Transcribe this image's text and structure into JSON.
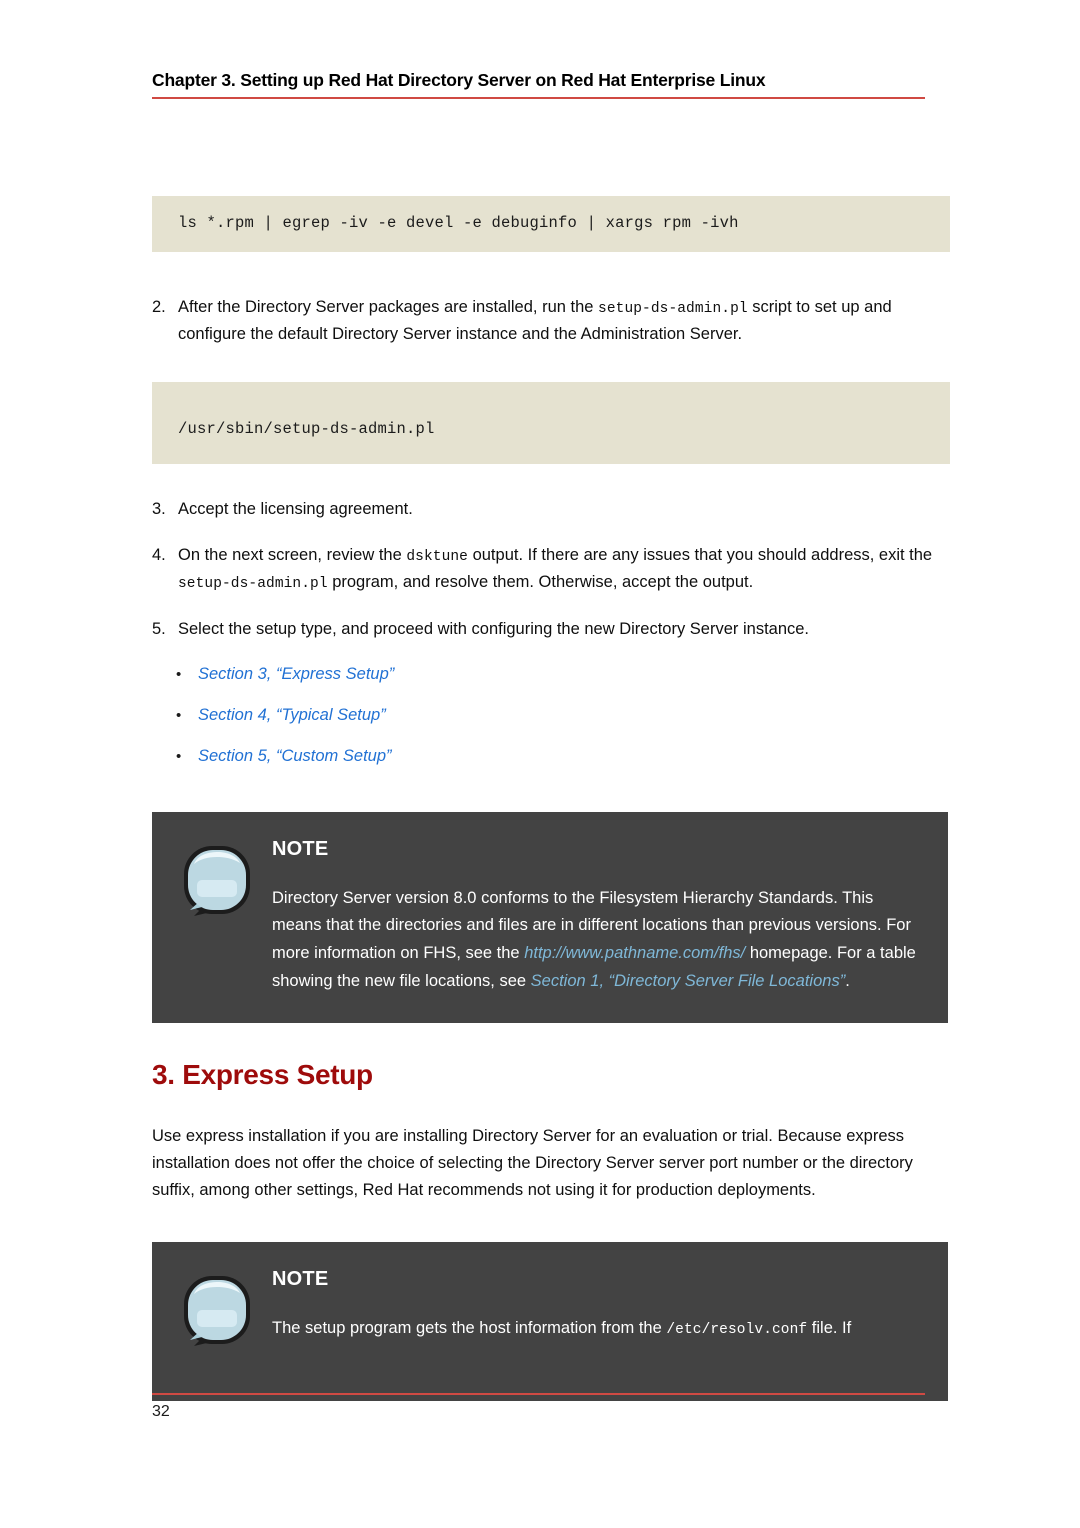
{
  "header": {
    "title": "Chapter 3. Setting up Red Hat Directory Server on Red Hat Enterprise Linux"
  },
  "colors": {
    "rule_red": "#d04a43",
    "heading_red": "#9e0b0b",
    "code_background": "#e5e2d0",
    "note_background": "#434343",
    "link_blue": "#2171d4",
    "note_link_blue": "#7fb8d8"
  },
  "code_blocks": {
    "rpm_install": "ls *.rpm | egrep -iv -e devel -e debuginfo | xargs rpm -ivh",
    "setup_script_path": "/usr/sbin/setup-ds-admin.pl"
  },
  "steps": [
    {
      "number": "2.",
      "parts": [
        {
          "type": "text",
          "value": "After the Directory Server packages are installed, run the "
        },
        {
          "type": "code",
          "value": "setup-ds-admin.pl"
        },
        {
          "type": "text",
          "value": " script to set up and configure the default Directory Server instance and the Administration Server."
        }
      ]
    },
    {
      "number": "3.",
      "parts": [
        {
          "type": "text",
          "value": "Accept the licensing agreement."
        }
      ]
    },
    {
      "number": "4.",
      "parts": [
        {
          "type": "text",
          "value": "On the next screen, review the "
        },
        {
          "type": "code",
          "value": "dsktune"
        },
        {
          "type": "text",
          "value": " output. If there are any issues that you should address, exit the "
        },
        {
          "type": "code",
          "value": "setup-ds-admin.pl"
        },
        {
          "type": "text",
          "value": " program, and resolve them. Otherwise, accept the output."
        }
      ]
    },
    {
      "number": "5.",
      "parts": [
        {
          "type": "text",
          "value": "Select the setup type, and proceed with configuring the new Directory Server instance."
        }
      ]
    }
  ],
  "xrefs": {
    "bullet": "•",
    "items": [
      {
        "label": "Section 3, “Express Setup”"
      },
      {
        "label": "Section 4, “Typical Setup”"
      },
      {
        "label": "Section 5, “Custom Setup”"
      }
    ]
  },
  "note_fhs": {
    "label": "NOTE",
    "icon": "speech-bubble-icon",
    "text_1": "Directory Server version 8.0 conforms to the Filesystem Hierarchy Standards. This means that the directories and files are in different locations than previous versions. For more information on FHS, see the ",
    "link_1": "http://www.pathname.com/fhs/",
    "text_2": " homepage. For a table showing the new file locations, see ",
    "link_2": "Section 1, “Directory Server File Locations”",
    "text_3": "."
  },
  "section": {
    "title": "3. Express Setup",
    "paragraph": "Use express installation if you are installing Directory Server for an evaluation or trial. Because express installation does not offer the choice of selecting the Directory Server server port number or the directory suffix, among other settings, Red Hat recommends not using it for production deployments."
  },
  "note_resolv": {
    "label": "NOTE",
    "icon": "speech-bubble-icon",
    "text_1": "The setup program gets the host information from the ",
    "code_1": "/etc/resolv.conf",
    "text_2": " file. If"
  },
  "footer": {
    "page_number": "32"
  }
}
